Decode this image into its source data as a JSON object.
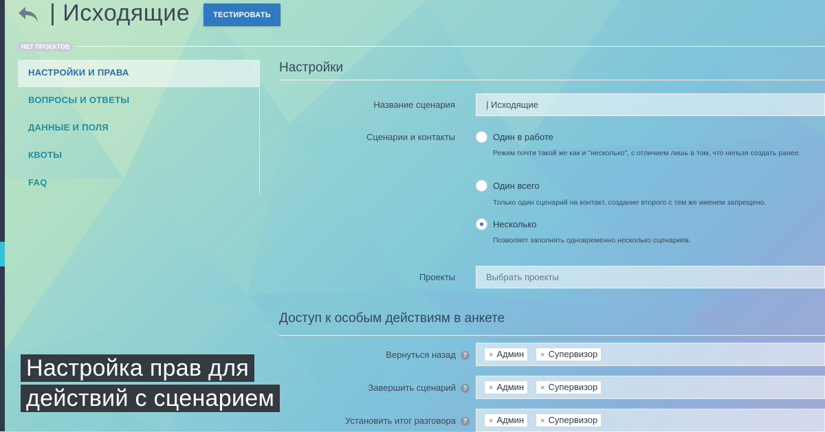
{
  "header": {
    "title": "| Исходящие",
    "test_button": "ТЕСТИРОВАТЬ",
    "no_projects_badge": "НЕТ ПРОЕКТОВ"
  },
  "sidebar": {
    "items": [
      {
        "label": "НАСТРОЙКИ И ПРАВА",
        "active": true
      },
      {
        "label": "ВОПРОСЫ И ОТВЕТЫ",
        "active": false
      },
      {
        "label": "ДАННЫЕ И ПОЛЯ",
        "active": false
      },
      {
        "label": "КВОТЫ",
        "active": false
      },
      {
        "label": "FAQ",
        "active": false
      }
    ]
  },
  "settings": {
    "title": "Настройки",
    "scenario_name_label": "Название сценария",
    "scenario_name_value": "| Исходящие",
    "contacts_label": "Сценарии и контакты",
    "options": [
      {
        "label": "Один в работе",
        "desc": "Режим почти такой же как и \"несколько\", с отличием лишь в том, что нельзя создать ранее.",
        "checked": false
      },
      {
        "label": "Один всего",
        "desc": "Только один сценарий на контакт, создание второго с тем же именем запрещено.",
        "checked": false
      },
      {
        "label": "Несколько",
        "desc": "Позволяет заполнять одновременно несколько сценариев.",
        "checked": true
      }
    ],
    "projects_label": "Проекты",
    "projects_placeholder": "Выбрать проекты"
  },
  "access": {
    "title": "Доступ к особым действиям в анкете",
    "rows": [
      {
        "label": "Вернуться назад",
        "tags": [
          "Админ",
          "Супервизор"
        ]
      },
      {
        "label": "Завершить сценарий",
        "tags": [
          "Админ",
          "Супервизор"
        ]
      },
      {
        "label": "Установить итог разговора",
        "tags": [
          "Админ",
          "Супервизор"
        ]
      }
    ]
  },
  "caption": {
    "line1": "Настройка прав для",
    "line2": "действий с сценарием"
  },
  "colors": {
    "accent": "#2f79c0",
    "link": "#1f8fa5",
    "leftbar": "#2f3b4a"
  }
}
